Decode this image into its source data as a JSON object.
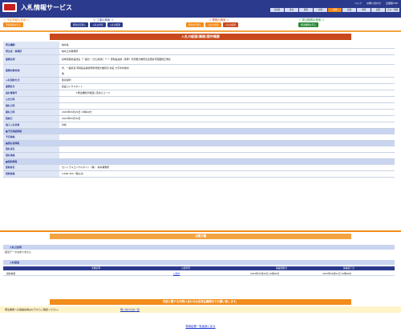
{
  "header": {
    "title": "入札情報サービス",
    "top_links": [
      "ヘルプ",
      "お問い合わせ",
      "全国版TOP"
    ],
    "regions": [
      "北海道",
      "東北",
      "関東",
      "北陸",
      "中部",
      "近畿",
      "中国",
      "四国",
      "九州・沖縄"
    ],
    "active_region": "中部"
  },
  "nav": {
    "groups": [
      {
        "title": "＜ 予定情報の検索 ＞",
        "title_color": "#f28c1a",
        "buttons": [
          "予定情報を見る"
        ]
      },
      {
        "title": "＜ 工事の検索 ＞",
        "title_color": "#2b3a8c",
        "buttons": [
          "発注の見通し",
          "入札公告等",
          "入札の結果"
        ]
      },
      {
        "title": "＜ 業務の検索 ＞",
        "title_color": "#c8481c",
        "buttons": [
          "発注の見通し",
          "入札公告等",
          "入札の結果"
        ]
      },
      {
        "title": "＜ 発注機関の検索 ＞",
        "title_color": "#2a8a3a",
        "buttons": [
          "発注機関を見る"
        ]
      }
    ]
  },
  "panel_title": "入札の経過(業務)案件概要",
  "info_rows": [
    {
      "label": "発注機関",
      "value": "岐阜県"
    },
    {
      "label": "発注者・事務所",
      "value": "岐阜土木事務所"
    },
    {
      "label": "業務名称",
      "value": "県単道路新設改良（一般分）［ゼロ県債］（一）弥勒長良線（仮称）新曽根大橋周辺変更許可図面修正委託"
    },
    {
      "label": "業務対象地域",
      "value": "市、一般県道 弥勒長良線仮称新曽根大橋周辺  県名 大字木村地内",
      "value2": "他"
    },
    {
      "label": "入札契約方式",
      "value": "随意契約"
    },
    {
      "label": "業務区分",
      "value": "建設コンサルタント"
    },
    {
      "label": "設計書番号",
      "value": "＊発注機関が独自に定めるコード"
    },
    {
      "label": "公告日時",
      "value": ""
    },
    {
      "label": "開札日時",
      "value": ""
    },
    {
      "label": "開札日時",
      "value": "2023年05月29日 13時00分"
    },
    {
      "label": "契約日",
      "value": "2023年05月30日"
    },
    {
      "label": "電子入札対象",
      "value": "対象"
    }
  ],
  "sections": [
    {
      "title": "■予定価格情報",
      "rows": [
        {
          "label": "予定価格",
          "value": ""
        }
      ]
    },
    {
      "title": "■落札者情報",
      "rows": [
        {
          "label": "落札者名",
          "value": ""
        },
        {
          "label": "落札価格",
          "value": ""
        }
      ]
    },
    {
      "title": "■契約情報",
      "rows": [
        {
          "label": "契約者名",
          "value": "セントラルコンサルタント（株）　岐阜事務所"
        },
        {
          "label": "契約価格",
          "value": "4,690,300（税込み）"
        }
      ]
    }
  ],
  "docs": {
    "title": "公開文書",
    "notice_heading": "入札公告等",
    "notice_empty": "該当データはありません",
    "results_heading": "入札経過",
    "columns": [
      "文書名称",
      "公開状況",
      "掲載開始日",
      "掲載終了日"
    ],
    "row": {
      "name": "契約情報",
      "status": "公開中",
      "start": "2023年05月29日 10時00分",
      "end": "2023年06月01日 10時00分"
    }
  },
  "contact_notice": "内容に関するお問い合わせは各発注機関までお願い致します。",
  "footer": {
    "left_text": "発注機関への連絡先等は以下からご確認ください。",
    "link_text": "問い合わせ先一覧"
  },
  "back_link": "検索結果一覧画面に戻る",
  "colors": {
    "brand": "#2b3a8c",
    "accent": "#f28c1a",
    "panel": "#c8481c"
  }
}
